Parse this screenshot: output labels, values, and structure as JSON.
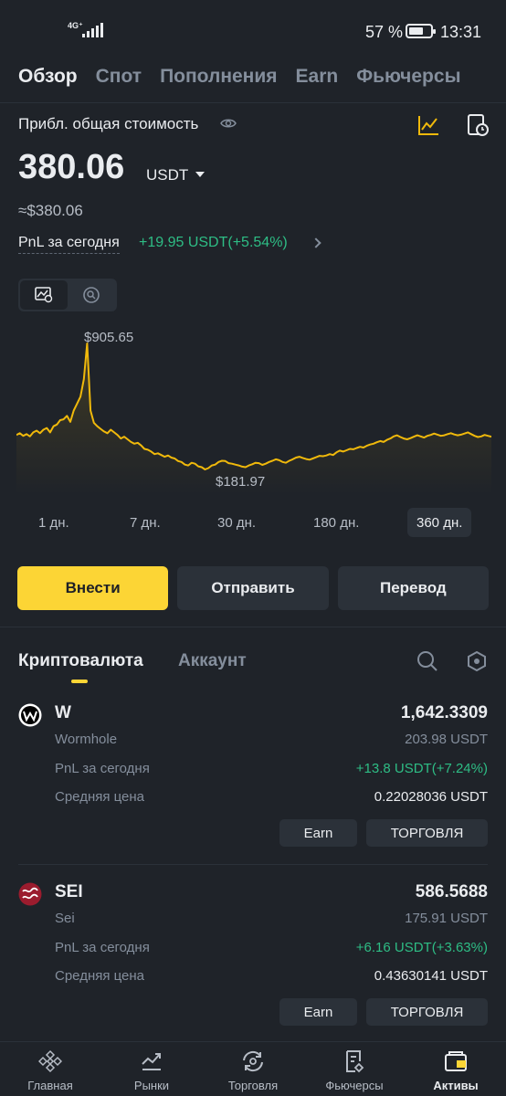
{
  "status_bar": {
    "network": "4G⁺",
    "battery_percent": "57 %",
    "time": "13:31"
  },
  "top_tabs": [
    "Обзор",
    "Спот",
    "Пополнения",
    "Earn",
    "Фьючерсы"
  ],
  "overview": {
    "total_label": "Прибл. общая стоимость",
    "balance": "380.06",
    "balance_unit": "USDT",
    "approx_usd": "≈$380.06",
    "pnl_label": "PnL за сегодня",
    "pnl_value": "+19.95 USDT(+5.54%)"
  },
  "chart_data": {
    "type": "line",
    "title": "",
    "xlabel": "",
    "ylabel": "",
    "annotations": {
      "max_label": "$905.65",
      "min_label": "$181.97"
    },
    "max_value": 905.65,
    "min_value": 181.97,
    "period": "360 дн.",
    "grid": false,
    "color": "#f0b90b",
    "y": [
      380,
      390,
      375,
      385,
      372,
      395,
      405,
      390,
      410,
      420,
      395,
      430,
      440,
      465,
      470,
      490,
      455,
      520,
      560,
      600,
      700,
      905.65,
      520,
      450,
      430,
      415,
      400,
      390,
      410,
      395,
      380,
      360,
      370,
      355,
      340,
      330,
      335,
      320,
      300,
      295,
      285,
      270,
      275,
      265,
      255,
      262,
      250,
      245,
      230,
      225,
      210,
      205,
      220,
      215,
      200,
      195,
      181.97,
      190,
      205,
      210,
      225,
      232,
      230,
      218,
      215,
      210,
      205,
      198,
      195,
      205,
      212,
      220,
      218,
      208,
      215,
      225,
      232,
      240,
      235,
      225,
      220,
      232,
      240,
      250,
      255,
      248,
      242,
      238,
      245,
      252,
      260,
      258,
      262,
      270,
      265,
      280,
      290,
      285,
      292,
      300,
      298,
      305,
      312,
      308,
      318,
      325,
      330,
      338,
      345,
      340,
      352,
      360,
      372,
      378,
      368,
      360,
      355,
      362,
      370,
      378,
      372,
      365,
      375,
      380,
      388,
      382,
      375,
      378,
      385,
      390,
      383,
      378,
      382,
      388,
      395,
      385,
      375,
      368,
      372,
      380,
      375,
      370
    ]
  },
  "chart_ranges": [
    "1 дн.",
    "7 дн.",
    "30 дн.",
    "180 дн.",
    "360 дн."
  ],
  "actions": {
    "deposit": "Внести",
    "send": "Отправить",
    "transfer": "Перевод"
  },
  "section_tabs": {
    "crypto": "Криптовалюта",
    "account": "Аккаунт"
  },
  "assets": [
    {
      "symbol": "W",
      "name": "Wormhole",
      "quantity": "1,642.3309",
      "usdt_value": "203.98 USDT",
      "pnl_label": "PnL за сегодня",
      "pnl_value": "+13.8 USDT(+7.24%)",
      "avg_label": "Средняя цена",
      "avg_value": "0.22028036 USDT",
      "earn_label": "Earn",
      "trade_label": "ТОРГОВЛЯ"
    },
    {
      "symbol": "SEI",
      "name": "Sei",
      "quantity": "586.5688",
      "usdt_value": "175.91 USDT",
      "pnl_label": "PnL за сегодня",
      "pnl_value": "+6.16 USDT(+3.63%)",
      "avg_label": "Средняя цена",
      "avg_value": "0.43630141 USDT",
      "earn_label": "Earn",
      "trade_label": "ТОРГОВЛЯ"
    }
  ],
  "bottom_nav": [
    "Главная",
    "Рынки",
    "Торговля",
    "Фьючерсы",
    "Активы"
  ],
  "colors": {
    "accent": "#fcd535",
    "positive": "#2ebd85",
    "background": "#1f2329",
    "chart_line": "#f0b90b"
  }
}
